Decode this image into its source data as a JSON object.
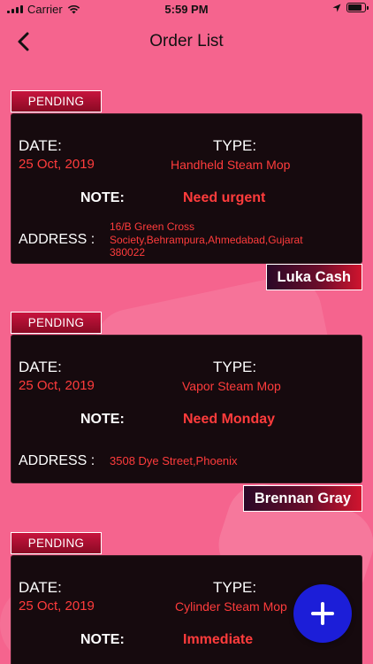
{
  "status_bar": {
    "carrier": "Carrier",
    "time": "5:59 PM"
  },
  "header": {
    "title": "Order List",
    "back_icon": "chevron-left-icon"
  },
  "labels": {
    "date": "DATE:",
    "type": "TYPE:",
    "note": "NOTE:",
    "address": "ADDRESS :"
  },
  "orders": [
    {
      "status": "PENDING",
      "date": "25 Oct, 2019",
      "type": "Handheld Steam Mop",
      "note": "Need urgent",
      "address": "16/B Green Cross Society,Behrampura,Ahmedabad,Gujarat 380022",
      "customer": "Luka Cash"
    },
    {
      "status": "PENDING",
      "date": "25 Oct, 2019",
      "type": "Vapor Steam Mop",
      "note": "Need Monday",
      "address": "3508 Dye Street,Phoenix",
      "customer": "Brennan Gray"
    },
    {
      "status": "PENDING",
      "date": "25 Oct, 2019",
      "type": "Cylinder Steam Mop",
      "note": "Immediate"
    }
  ],
  "fab": {
    "icon": "plus-icon"
  },
  "colors": {
    "background": "#f5648e",
    "card": "#160a0e",
    "value_red": "#ff3c3c",
    "fab_blue": "#1c1ed8"
  }
}
